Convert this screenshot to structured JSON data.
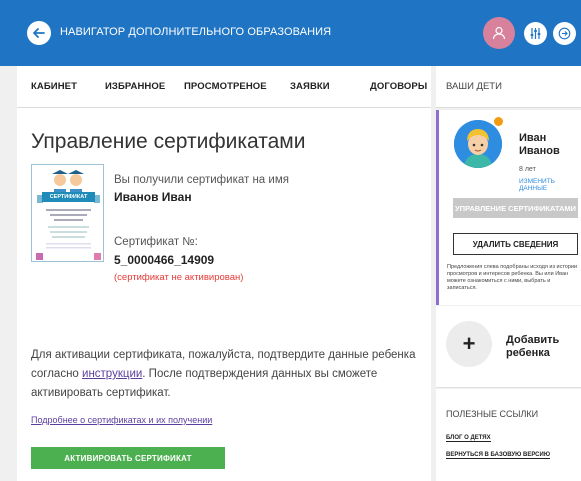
{
  "header": {
    "title": "НАВИГАТОР ДОПОЛНИТЕЛЬНОГО ОБРАЗОВАНИЯ",
    "brand_color": "#1f75c4"
  },
  "tabs": [
    "КАБИНЕТ",
    "ИЗБРАННОЕ",
    "ПРОСМОТРЕНОЕ",
    "ЗАЯВКИ",
    "ДОГОВОРЫ"
  ],
  "main": {
    "title": "Управление сертификатами",
    "certificate": {
      "image_heading": "СЕРТИФИКАТ",
      "received_text": "Вы получили сертификат на имя",
      "holder_name": "Иванов Иван",
      "number_label": "Сертификат №:",
      "number": "5_0000466_14909",
      "status": "(сертификат не активирован)",
      "status_color": "#e53935"
    },
    "instructions_before": "Для активации сертификата, пожалуйста, подтвердите данные ребенка согласно ",
    "instructions_link": "инструкции",
    "instructions_after": ". После подтверждения данных вы сможете активировать сертификат.",
    "more_link": "Подробнее о сертификатах и их получении",
    "activate_button": "АКТИВИРОВАТЬ СЕРТИФИКАТ",
    "activate_color": "#4caf50"
  },
  "sidebar": {
    "header": "ВАШИ ДЕТИ",
    "child": {
      "first_name": "Иван",
      "last_name": "Иванов",
      "age": "8 лет",
      "change_link": "ИЗМЕНИТЬ ДАННЫЕ",
      "manage_button": "УПРАВЛЕНИЕ СЕРТИФИКАТАМИ",
      "delete_button": "УДАЛИТЬ СВЕДЕНИЯ",
      "note": "Предложения слева подобраны исходя из истории просмотров и интересов ребенка. Вы или Иван можете ознакомиться с ними, выбрать и записаться."
    },
    "add_child": {
      "line1": "Добавить",
      "line2": "ребенка"
    },
    "links": {
      "title": "ПОЛЕЗНЫЕ ССЫЛКИ",
      "items": [
        "БЛОГ О ДЕТЯХ",
        "ВЕРНУТЬСЯ В БАЗОВУЮ ВЕРСИЮ"
      ]
    }
  }
}
